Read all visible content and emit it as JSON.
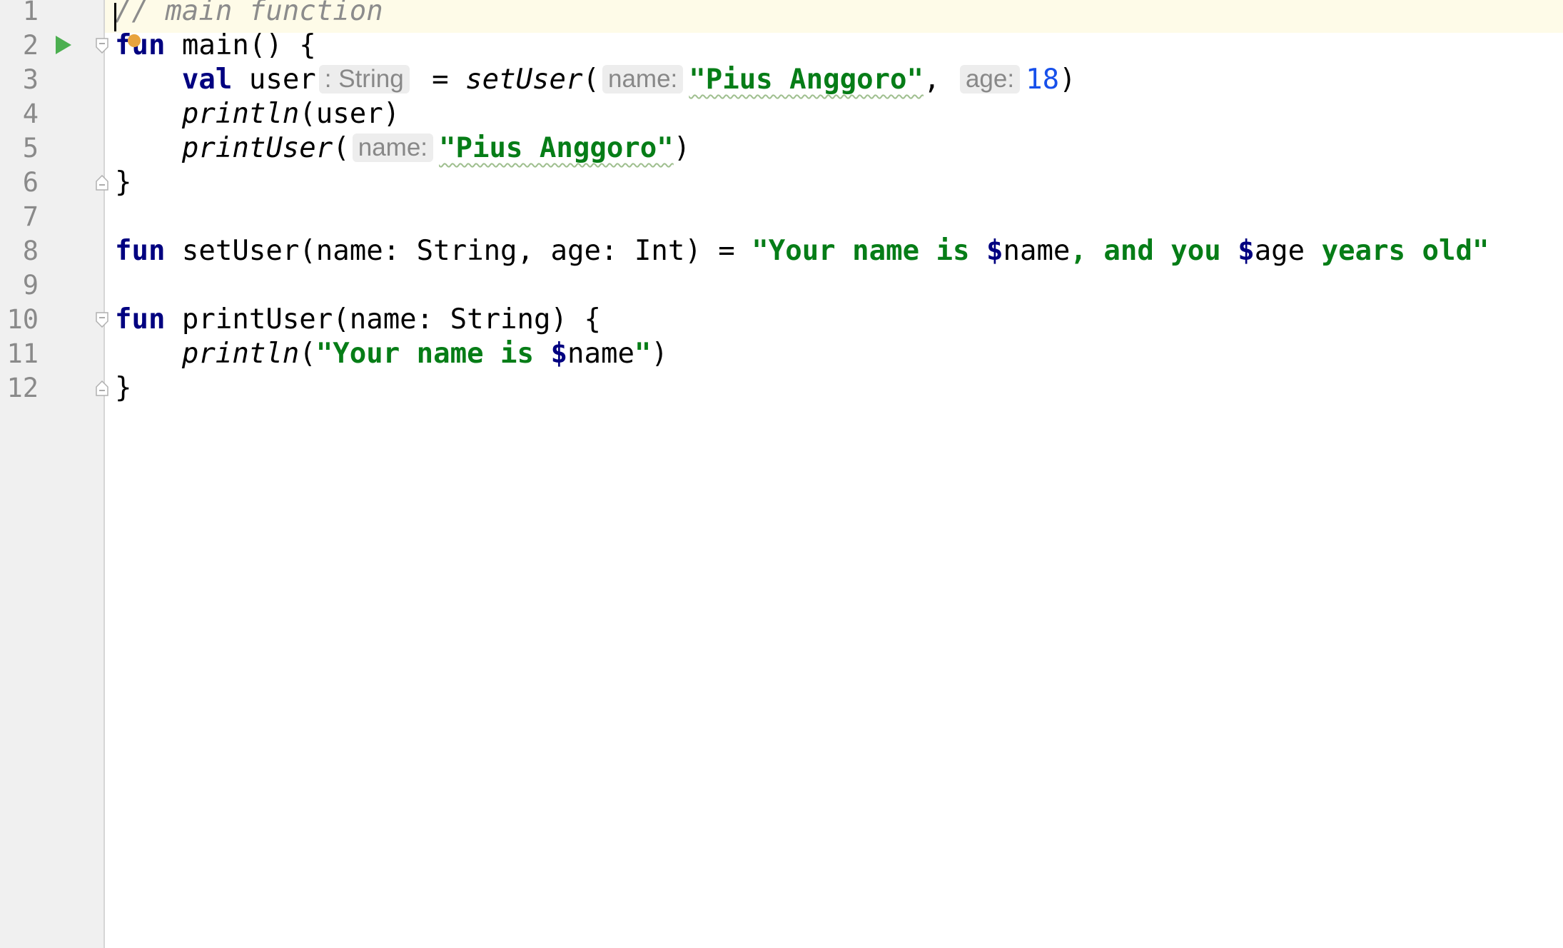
{
  "editor": {
    "lines": [
      {
        "n": "1",
        "comment": "// main function"
      },
      {
        "n": "2",
        "kw": "fun",
        "rest": " main() {"
      },
      {
        "n": "3",
        "kw": "val",
        "name": " user",
        "type_hint": ": String",
        "eq": " = ",
        "call": "setUser",
        "open": "(",
        "hint1": "name:",
        "arg1": "\"Pius Anggoro\"",
        "sep": ", ",
        "hint2": "age:",
        "arg2": "18",
        "close": ")"
      },
      {
        "n": "4",
        "call": "println",
        "rest": "(user)"
      },
      {
        "n": "5",
        "call": "printUser",
        "open": "(",
        "hint1": "name:",
        "arg1": "\"Pius Anggoro\"",
        "close": ")"
      },
      {
        "n": "6",
        "rest": "}"
      },
      {
        "n": "7"
      },
      {
        "n": "8",
        "kw": "fun",
        "sig": " setUser(name: String, age: Int) = ",
        "s1": "\"Your name is ",
        "d1": "$",
        "v1": "name",
        "s2": ", and you ",
        "d2": "$",
        "v2": "age",
        "s3": " years old\""
      },
      {
        "n": "9"
      },
      {
        "n": "10",
        "kw": "fun",
        "rest": " printUser(name: String) {"
      },
      {
        "n": "11",
        "call": "println",
        "open": "(",
        "s1": "\"Your name is ",
        "d1": "$",
        "v1": "name",
        "s2": "\"",
        "close": ")"
      },
      {
        "n": "12",
        "rest": "}"
      }
    ]
  },
  "colors": {
    "keyword": "#000080",
    "string": "#067d17",
    "number": "#1750eb",
    "comment": "#8c8c8c",
    "gutter": "#f0f0f0",
    "caret_row": "#fefbe8",
    "run": "#4caf50",
    "bulb": "#e8a33d"
  },
  "icons": {
    "run": "run-icon",
    "fold": "fold-icon",
    "intention": "bulb-icon"
  }
}
